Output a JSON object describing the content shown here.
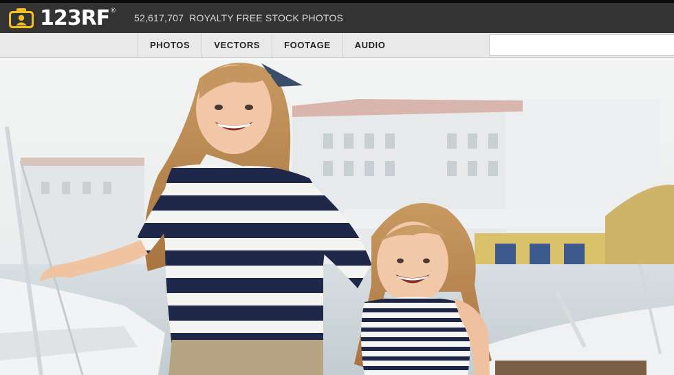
{
  "brand": {
    "name": "123RF",
    "reg": "®"
  },
  "tagline": {
    "count": "52,617,707",
    "text": "ROYALTY FREE STOCK PHOTOS"
  },
  "nav": [
    {
      "label": "PHOTOS"
    },
    {
      "label": "VECTORS"
    },
    {
      "label": "FOOTAGE"
    },
    {
      "label": "AUDIO"
    }
  ],
  "search": {
    "value": "",
    "placeholder": ""
  },
  "colors": {
    "logo_yellow": "#f4c01e",
    "topbar": "#333333",
    "navbar": "#e9e9e9"
  }
}
